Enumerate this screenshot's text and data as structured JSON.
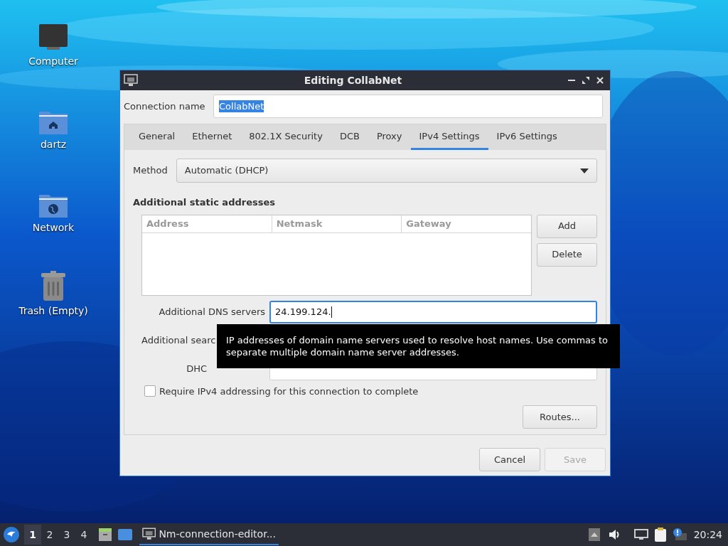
{
  "desktop": {
    "icons": [
      {
        "label": "Computer",
        "kind": "computer"
      },
      {
        "label": "dartz",
        "kind": "home"
      },
      {
        "label": "Network",
        "kind": "network"
      },
      {
        "label": "Trash (Empty)",
        "kind": "trash"
      }
    ]
  },
  "window": {
    "title": "Editing CollabNet",
    "connection_name": {
      "label": "Connection name",
      "value": "CollabNet"
    },
    "tabs": [
      {
        "label": "General",
        "selected": false
      },
      {
        "label": "Ethernet",
        "selected": false
      },
      {
        "label": "802.1X Security",
        "selected": false
      },
      {
        "label": "DCB",
        "selected": false
      },
      {
        "label": "Proxy",
        "selected": false
      },
      {
        "label": "IPv4 Settings",
        "selected": true
      },
      {
        "label": "IPv6 Settings",
        "selected": false
      }
    ],
    "method": {
      "label": "Method",
      "value": "Automatic (DHCP)"
    },
    "static_addresses": {
      "title": "Additional static addresses",
      "columns": [
        "Address",
        "Netmask",
        "Gateway"
      ],
      "buttons": [
        {
          "label": "Add",
          "disabled": false
        },
        {
          "label": "Delete",
          "disabled": false
        }
      ]
    },
    "dns": {
      "label": "Additional DNS servers",
      "value": "24.199.124."
    },
    "search_domains": {
      "label": "Additional searc"
    },
    "dhcp_client_id": {
      "label": "DHC"
    },
    "require_ipv4": {
      "label": "Require IPv4 addressing for this connection to complete",
      "checked": false
    },
    "routes_button": "Routes...",
    "tooltip": "IP addresses of domain name servers used to resolve host names. Use commas to separate multiple domain name server addresses.",
    "buttons": [
      {
        "label": "Cancel",
        "disabled": false
      },
      {
        "label": "Save",
        "disabled": true
      }
    ]
  },
  "taskbar": {
    "workspaces": [
      {
        "label": "1",
        "selected": true
      },
      {
        "label": "2",
        "selected": false
      },
      {
        "label": "3",
        "selected": false
      },
      {
        "label": "4",
        "selected": false
      }
    ],
    "task": "Nm-connection-editor...",
    "clock": "20:24"
  }
}
